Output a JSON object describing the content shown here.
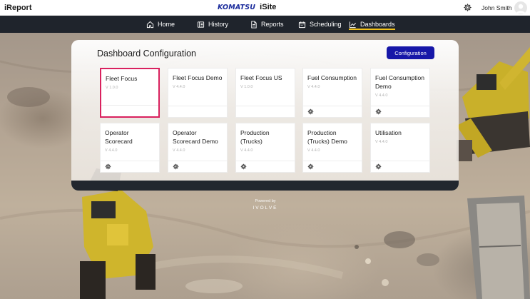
{
  "app": {
    "title": "iReport"
  },
  "brand": {
    "logo": "KOMATSU",
    "product": "iSite"
  },
  "user": {
    "name": "John Smith"
  },
  "icons": {
    "settings": "gear-icon",
    "avatar": "user-avatar-icon"
  },
  "nav": [
    {
      "label": "Home",
      "icon": "home-icon",
      "active": false
    },
    {
      "label": "History",
      "icon": "history-icon",
      "active": false
    },
    {
      "label": "Reports",
      "icon": "reports-icon",
      "active": false
    },
    {
      "label": "Scheduling",
      "icon": "calendar-icon",
      "active": false
    },
    {
      "label": "Dashboards",
      "icon": "chart-line-icon",
      "active": true
    }
  ],
  "panel": {
    "title": "Dashboard Configuration",
    "config_button": "Configuration"
  },
  "cards": [
    {
      "name": "Fleet Focus",
      "version": "V 1.0.0",
      "has_settings": false,
      "selected": true
    },
    {
      "name": "Fleet Focus Demo",
      "version": "V 4.4.0",
      "has_settings": false,
      "selected": false
    },
    {
      "name": "Fleet Focus US",
      "version": "V 1.0.0",
      "has_settings": false,
      "selected": false
    },
    {
      "name": "Fuel Consumption",
      "version": "V 4.4.0",
      "has_settings": true,
      "selected": false
    },
    {
      "name": "Fuel Consumption Demo",
      "version": "V 4.4.0",
      "has_settings": true,
      "selected": false
    },
    {
      "name": "Operator Scorecard",
      "version": "V 4.4.0",
      "has_settings": true,
      "selected": false
    },
    {
      "name": "Operator Scorecard Demo",
      "version": "V 4.4.0",
      "has_settings": true,
      "selected": false
    },
    {
      "name": "Production (Trucks)",
      "version": "V 4.4.0",
      "has_settings": true,
      "selected": false
    },
    {
      "name": "Production (Trucks) Demo",
      "version": "V 4.4.0",
      "has_settings": true,
      "selected": false
    },
    {
      "name": "Utilisation",
      "version": "V 4.4.0",
      "has_settings": true,
      "selected": false
    }
  ],
  "footer": {
    "powered_by": "Powered by",
    "logo": "IVOLVE"
  },
  "colors": {
    "nav_bg": "#1f242c",
    "accent": "#f2c21b",
    "primary_button": "#1717a8",
    "selected_border": "#d9215e"
  }
}
